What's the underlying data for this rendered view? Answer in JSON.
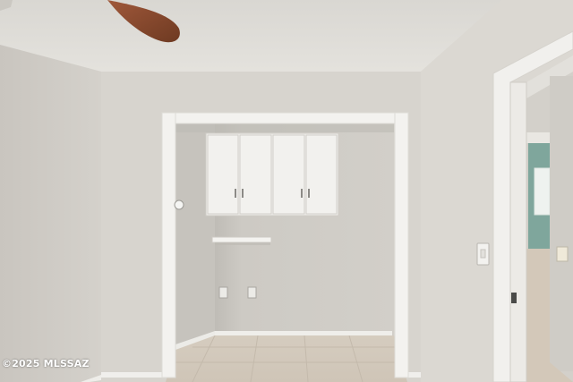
{
  "watermark": {
    "text": "©2025 MLSSAZ"
  },
  "scene": {
    "subject": "empty-room-with-laundry-alcove",
    "colors": {
      "ceiling": "#e1dfda",
      "left_wall": "#cfcbc5",
      "back_wall": "#d6d3cd",
      "right_wall": "#dad7d1",
      "alcove_wall": "#cbc8c2",
      "trim": "#f2f1ee",
      "floor_tile": "#d8cfc2",
      "fan_blade": "#8a4a2c",
      "far_room_wall": "#7fa69c"
    }
  }
}
